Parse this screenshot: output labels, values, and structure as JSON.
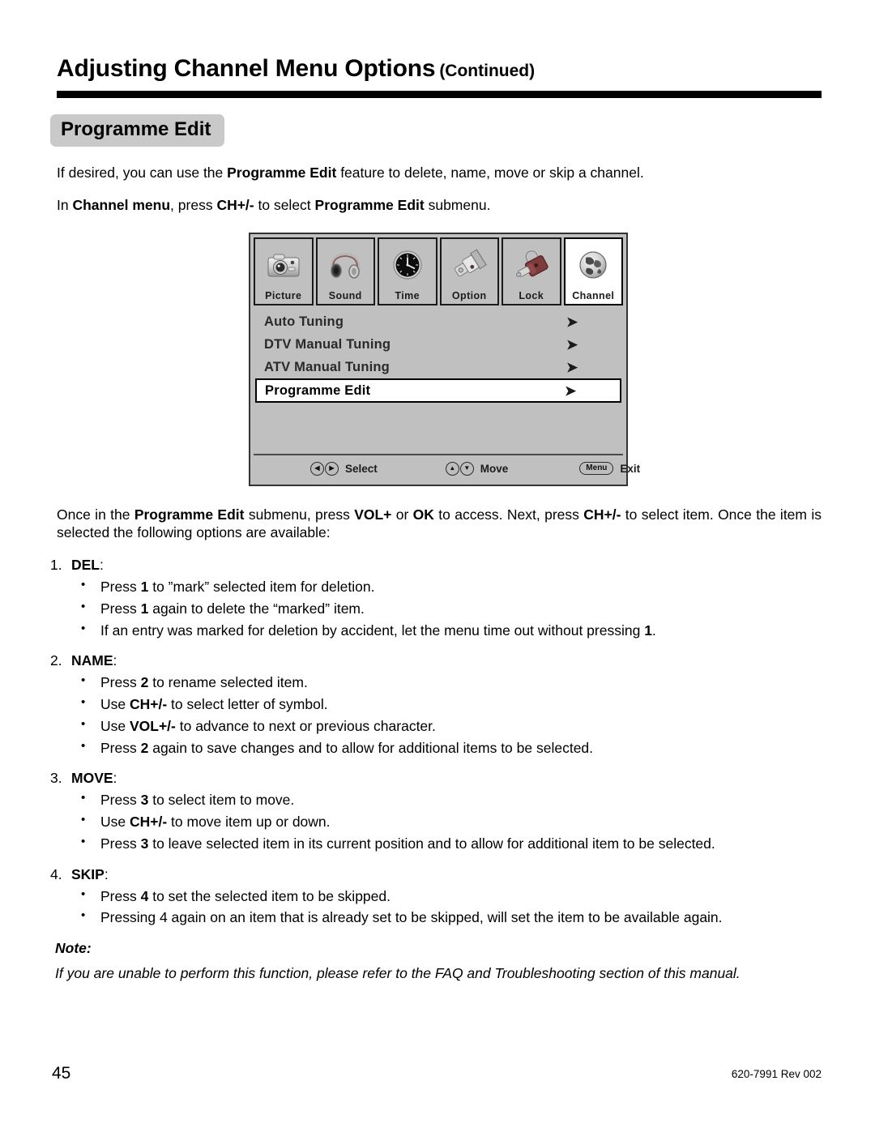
{
  "header": {
    "title": "Adjusting Channel Menu Options",
    "continued": "(Continued)"
  },
  "section": {
    "chip_label": "Programme Edit"
  },
  "intro": {
    "line1_a": "If desired, you can use the ",
    "line1_b": "Programme Edit",
    "line1_c": " feature to delete, name, move or skip a channel.",
    "line2_a": "In ",
    "line2_b": "Channel menu",
    "line2_c": ", press ",
    "line2_d": "CH+/-",
    "line2_e": " to select ",
    "line2_f": "Programme Edit",
    "line2_g": " submenu."
  },
  "osd": {
    "tabs": [
      {
        "label": "Picture",
        "icon": "camera-icon",
        "active": false
      },
      {
        "label": "Sound",
        "icon": "headphones-icon",
        "active": false
      },
      {
        "label": "Time",
        "icon": "clock-icon",
        "active": false
      },
      {
        "label": "Option",
        "icon": "connector-icon",
        "active": false
      },
      {
        "label": "Lock",
        "icon": "padlock-icon",
        "active": false
      },
      {
        "label": "Channel",
        "icon": "globe-icon",
        "active": true
      }
    ],
    "rows": [
      {
        "label": "Auto Tuning",
        "arrow": "➤",
        "selected": false
      },
      {
        "label": "DTV Manual Tuning",
        "arrow": "➤",
        "selected": false
      },
      {
        "label": "ATV Manual Tuning",
        "arrow": "➤",
        "selected": false
      },
      {
        "label": "Programme Edit",
        "arrow": "➤",
        "selected": true
      }
    ],
    "hints": {
      "select_label": "Select",
      "select_key_left": "◀",
      "select_key_right": "▶",
      "move_label": "Move",
      "move_key_up": "▲",
      "move_key_down": "▼",
      "exit_label": "Exit",
      "exit_key": "Menu"
    }
  },
  "body_copy": {
    "a": "Once in the ",
    "b": "Programme Edit",
    "c": " submenu, press ",
    "d": "VOL+",
    "e": " or ",
    "f": "OK",
    "g": " to access.  Next, press ",
    "h": "CH+/-",
    "i": " to select item. Once the item is selected the following options are available:"
  },
  "options": [
    {
      "num": "1.",
      "name": "DEL",
      "colon": ":",
      "bullets": [
        {
          "pre": "Press ",
          "key": "1",
          "post": " to ”mark” selected item for deletion."
        },
        {
          "pre": "Press ",
          "key": "1",
          "post": " again to delete the “marked” item."
        },
        {
          "pre": "If an entry was marked for deletion by accident, let the menu time out without pressing ",
          "key": "1",
          "post": "."
        }
      ]
    },
    {
      "num": "2.",
      "name": "NAME",
      "colon": ":",
      "bullets": [
        {
          "pre": "Press ",
          "key": "2",
          "post": " to rename selected item."
        },
        {
          "pre": "Use ",
          "key": "CH+/-",
          "post": " to select letter of symbol."
        },
        {
          "pre": "Use ",
          "key": "VOL+/-",
          "post": " to advance to next or previous character."
        },
        {
          "pre": "Press ",
          "key": "2",
          "post": " again to save changes and to allow for additional items to be selected."
        }
      ]
    },
    {
      "num": "3.",
      "name": "MOVE",
      "colon": ":",
      "bullets": [
        {
          "pre": "Press ",
          "key": "3",
          "post": " to select item to move."
        },
        {
          "pre": "Use ",
          "key": "CH+/-",
          "post": " to move item up or down."
        },
        {
          "pre": "Press ",
          "key": "3",
          "post": " to leave selected item in its current position and to allow for additional item to be selected."
        }
      ]
    },
    {
      "num": "4.",
      "name": "SKIP",
      "colon": ":",
      "bullets": [
        {
          "pre": "Press ",
          "key": "4",
          "post": " to set the selected item to be skipped."
        },
        {
          "pre": "Pressing 4 again on an item that is already set to be skipped, will set the item to be available again.",
          "key": "",
          "post": ""
        }
      ]
    }
  ],
  "note": {
    "title": "Note:",
    "body": "If you are unable to perform this function, please refer to the FAQ and Troubleshooting section of this manual."
  },
  "footer": {
    "page_number": "45",
    "revision": "620-7991 Rev 002"
  },
  "colors": {
    "chip_background": "#c9c9c9",
    "osd_background": "#c0c0c0",
    "osd_selected_background": "#ffffff",
    "rule": "#000000"
  }
}
